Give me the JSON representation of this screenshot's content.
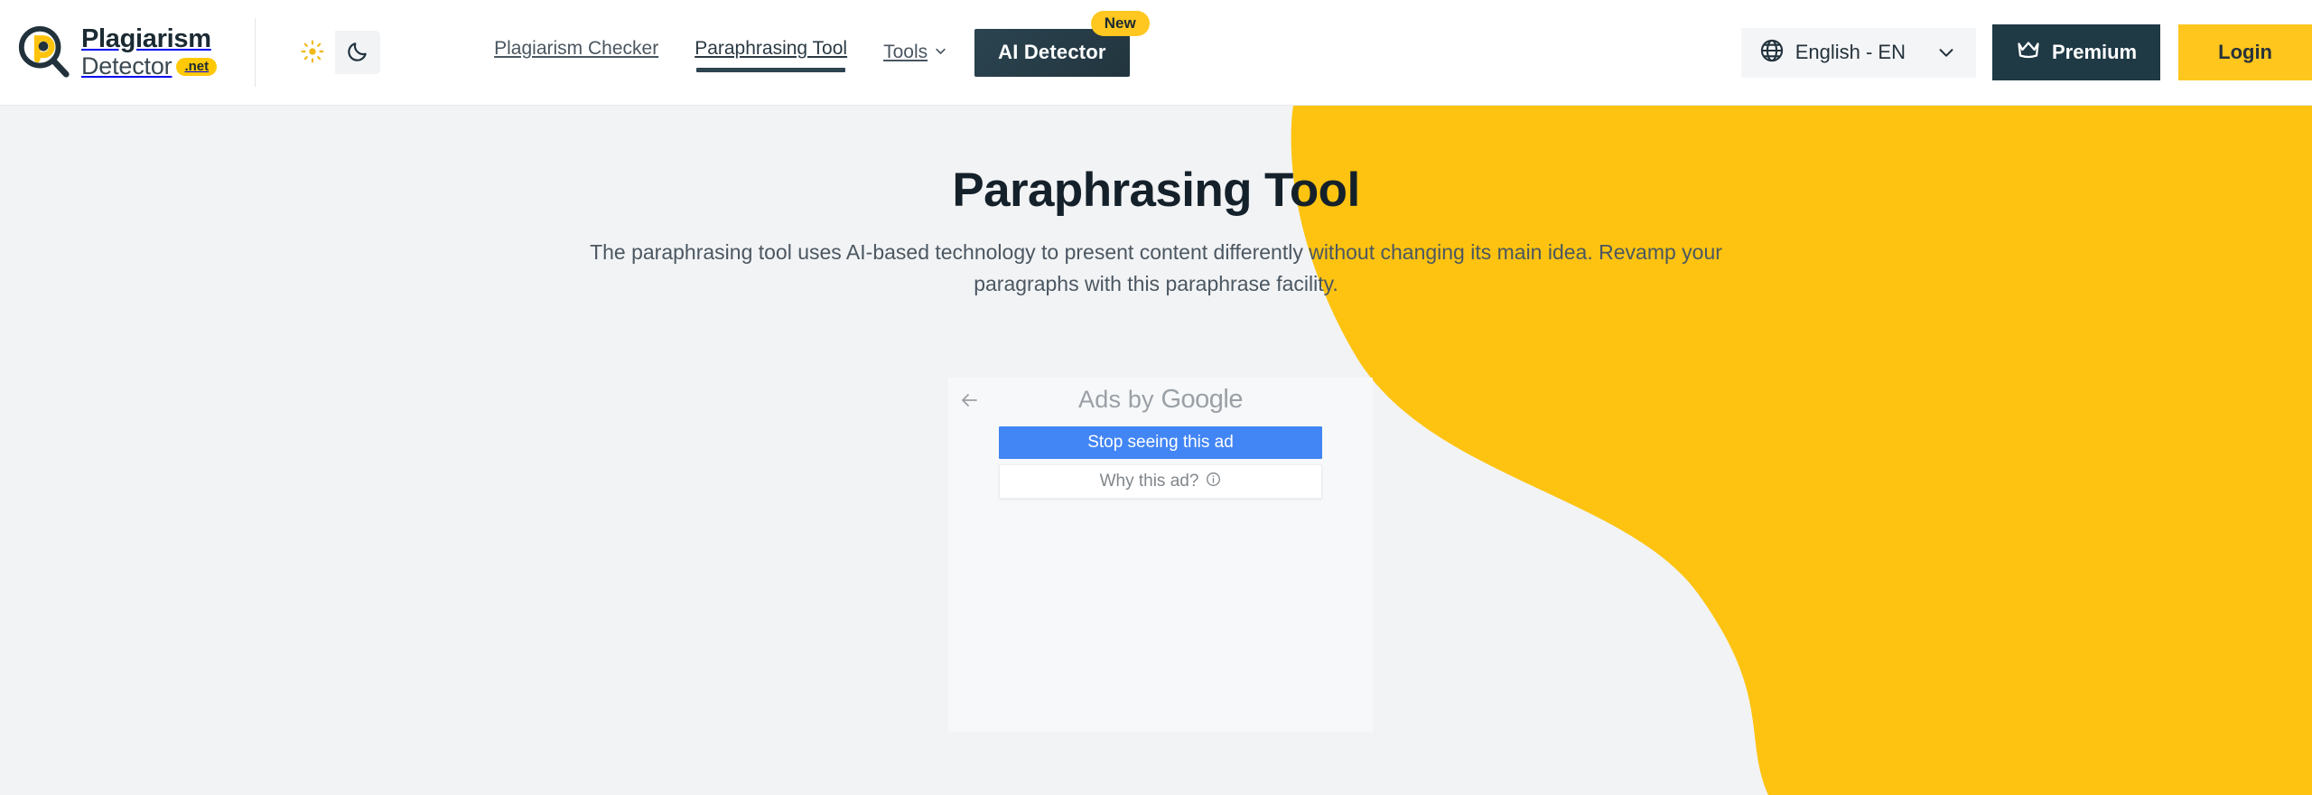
{
  "brand": {
    "name_line1": "Plagiarism",
    "name_line2": "Detector",
    "tld_badge": ".net",
    "logo_icon": "magnifier-p-logo-icon",
    "yellow": "#FFC907",
    "dark": "#1B2A33"
  },
  "header": {
    "theme_toggle": {
      "light_icon": "sun-icon",
      "dark_icon": "moon-icon",
      "active": "light"
    },
    "nav": [
      {
        "label": "Plagiarism Checker",
        "active": false,
        "has_dropdown": false
      },
      {
        "label": "Paraphrasing Tool",
        "active": true,
        "has_dropdown": false
      },
      {
        "label": "Tools",
        "active": false,
        "has_dropdown": true
      }
    ],
    "ai_detector": {
      "label": "AI Detector",
      "badge": "New",
      "badge_color": "#FFC71F",
      "button_color": "#2B4450"
    },
    "language": {
      "label": "English - EN",
      "globe_icon": "globe-icon",
      "chevron_icon": "chevron-down-icon"
    },
    "premium": {
      "label": "Premium",
      "icon": "crown-icon",
      "color": "#1F3945"
    },
    "login": {
      "label": "Login",
      "color": "#FFC61E"
    }
  },
  "main": {
    "title": "Paraphrasing Tool",
    "subtitle": "The paraphrasing tool uses AI-based technology to present content differently without changing its main idea. Revamp your paragraphs with this paraphrase facility."
  },
  "ad_panel": {
    "back_icon": "arrow-left-icon",
    "attribution_prefix": "Ads by ",
    "attribution_brand": "Google",
    "stop_button": "Stop seeing this ad",
    "why_button": "Why this ad?",
    "info_icon": "info-circle-icon",
    "stop_button_color": "#4285F4"
  },
  "decor": {
    "blob_color": "#FDC310",
    "page_background": "#F2F3F5"
  }
}
